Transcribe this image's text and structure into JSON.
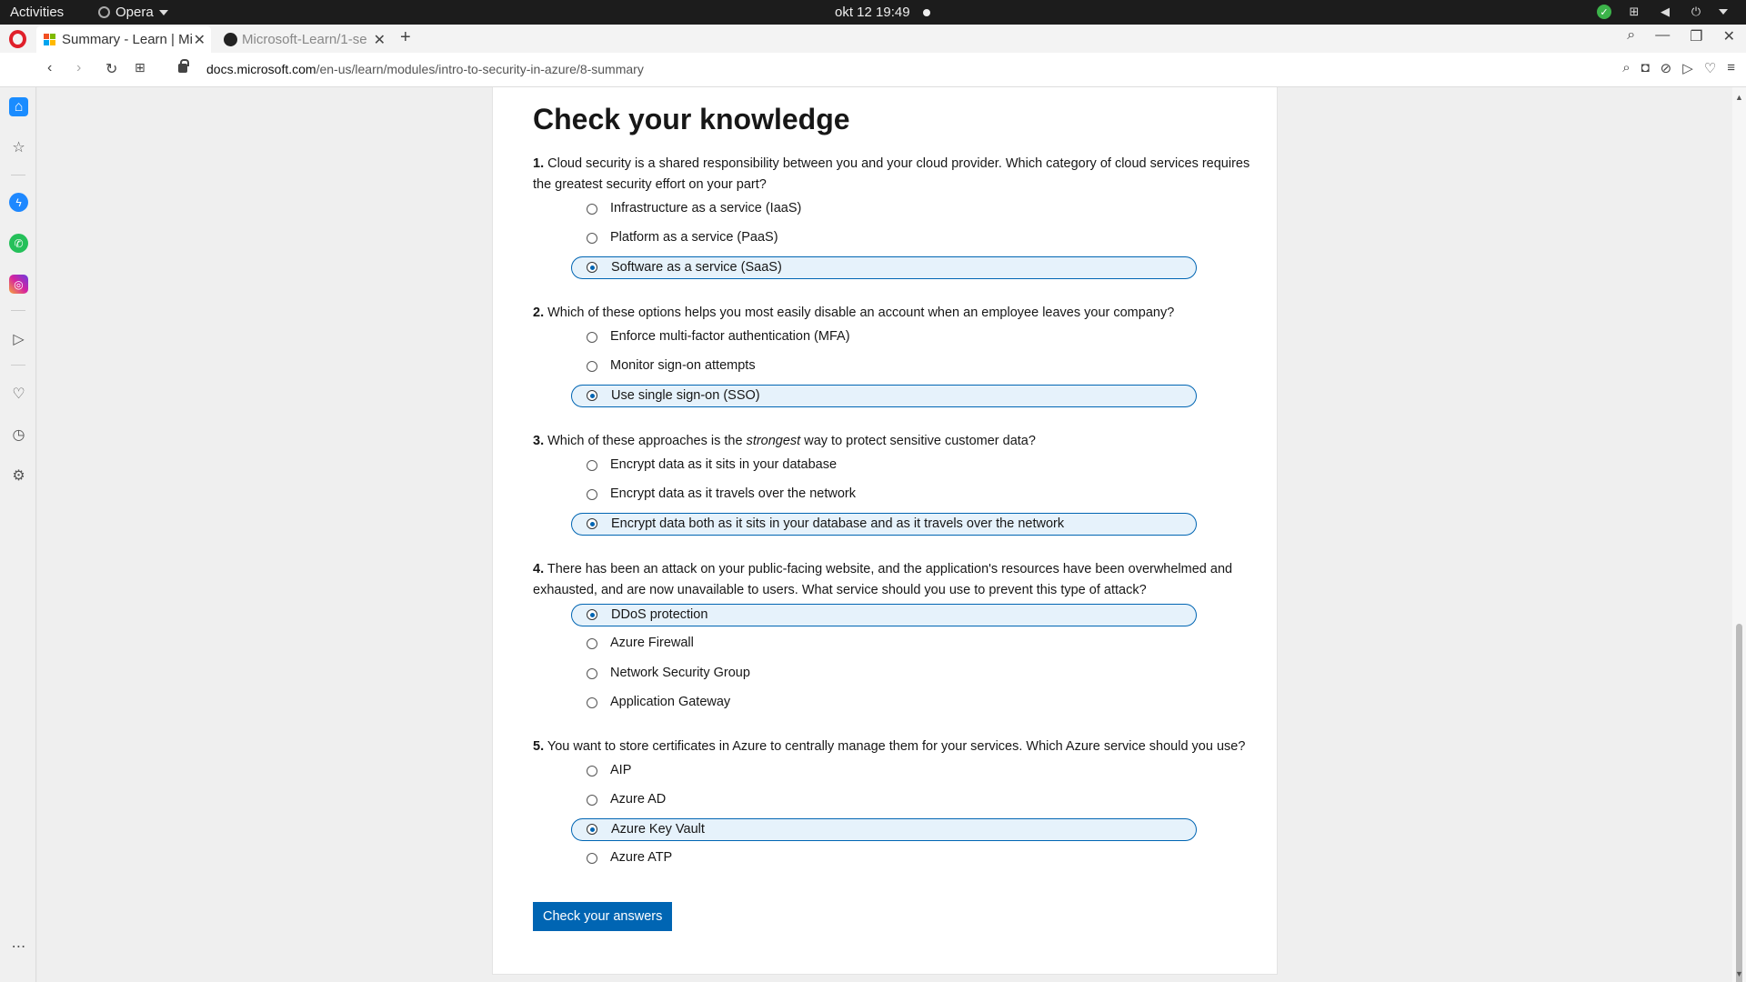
{
  "system": {
    "activities": "Activities",
    "app_name": "Opera",
    "clock": "okt 12  19:49"
  },
  "tabs": [
    {
      "label": "Summary - Learn | Mi",
      "active": true
    },
    {
      "label": "Microsoft-Learn/1-se",
      "active": false
    }
  ],
  "address": {
    "domain": "docs.microsoft.com",
    "path": "/en-us/learn/modules/intro-to-security-in-azure/8-summary"
  },
  "sidebar": {
    "items": [
      "home-icon",
      "star-icon",
      "messenger-icon",
      "whatsapp-icon",
      "instagram-icon",
      "send-icon",
      "heart-icon",
      "history-icon",
      "settings-icon",
      "more-icon"
    ]
  },
  "page": {
    "heading": "Check your knowledge",
    "submit_label": "Check your answers",
    "questions": [
      {
        "number": "1.",
        "text": "Cloud security is a shared responsibility between you and your cloud provider. Which category of cloud services requires the greatest security effort on your part?",
        "options": [
          "Infrastructure as a service (IaaS)",
          "Platform as a service (PaaS)",
          "Software as a service (SaaS)"
        ],
        "selected": 2
      },
      {
        "number": "2.",
        "text": "Which of these options helps you most easily disable an account when an employee leaves your company?",
        "options": [
          "Enforce multi-factor authentication (MFA)",
          "Monitor sign-on attempts",
          "Use single sign-on (SSO)"
        ],
        "selected": 2
      },
      {
        "number": "3.",
        "text_before": "Which of these approaches is the ",
        "text_em": "strongest",
        "text_after": " way to protect sensitive customer data?",
        "options": [
          "Encrypt data as it sits in your database",
          "Encrypt data as it travels over the network",
          "Encrypt data both as it sits in your database and as it travels over the network"
        ],
        "selected": 2
      },
      {
        "number": "4.",
        "text": "There has been an attack on your public-facing website, and the application's resources have been overwhelmed and exhausted, and are now unavailable to users. What service should you use to prevent this type of attack?",
        "options": [
          "DDoS protection",
          "Azure Firewall",
          "Network Security Group",
          "Application Gateway"
        ],
        "selected": 0
      },
      {
        "number": "5.",
        "text": "You want to store certificates in Azure to centrally manage them for your services. Which Azure service should you use?",
        "options": [
          "AIP",
          "Azure AD",
          "Azure Key Vault",
          "Azure ATP"
        ],
        "selected": 2
      }
    ]
  },
  "colors": {
    "accent": "#0065b3",
    "selected_bg": "#e6f2fb"
  }
}
